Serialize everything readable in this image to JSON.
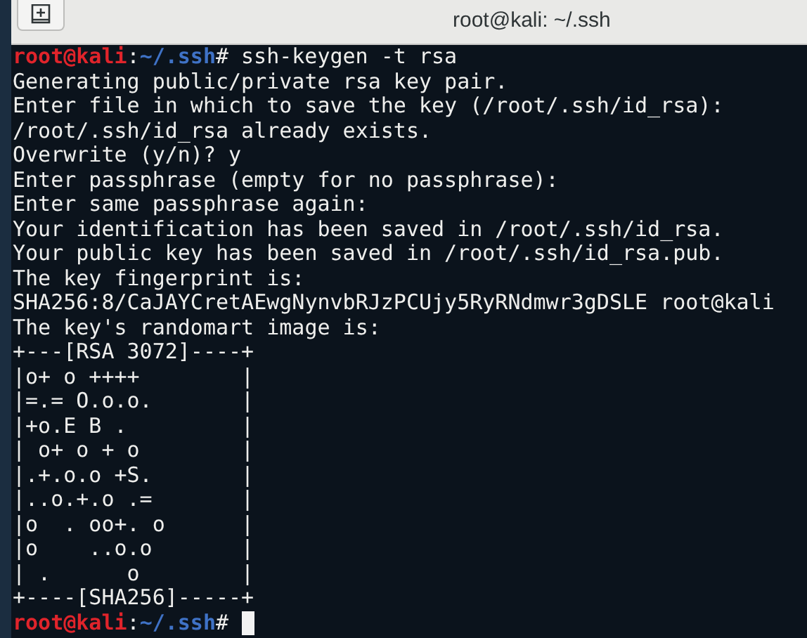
{
  "window": {
    "title": "root@kali: ~/.ssh"
  },
  "terminal": {
    "lines": [
      {
        "kind": "prompt",
        "host": "root@kali",
        "separator": ":",
        "path": "~/.ssh",
        "symbol": "#",
        "command": "ssh-keygen -t rsa"
      },
      {
        "kind": "output",
        "text": "Generating public/private rsa key pair."
      },
      {
        "kind": "output",
        "text": "Enter file in which to save the key (/root/.ssh/id_rsa):"
      },
      {
        "kind": "output",
        "text": "/root/.ssh/id_rsa already exists."
      },
      {
        "kind": "output",
        "text": "Overwrite (y/n)? y"
      },
      {
        "kind": "output",
        "text": "Enter passphrase (empty for no passphrase):"
      },
      {
        "kind": "output",
        "text": "Enter same passphrase again:"
      },
      {
        "kind": "output",
        "text": "Your identification has been saved in /root/.ssh/id_rsa."
      },
      {
        "kind": "output",
        "text": "Your public key has been saved in /root/.ssh/id_rsa.pub."
      },
      {
        "kind": "output",
        "text": "The key fingerprint is:"
      },
      {
        "kind": "output",
        "text": "SHA256:8/CaJAYCretAEwgNynvbRJzPCUjy5RyRNdmwr3gDSLE root@kali"
      },
      {
        "kind": "output",
        "text": "The key's randomart image is:"
      },
      {
        "kind": "output",
        "text": "+---[RSA 3072]----+"
      },
      {
        "kind": "output",
        "text": "|o+ o ++++        |"
      },
      {
        "kind": "output",
        "text": "|=.= O.o.o.       |"
      },
      {
        "kind": "output",
        "text": "|+o.E B .         |"
      },
      {
        "kind": "output",
        "text": "| o+ o + o        |"
      },
      {
        "kind": "output",
        "text": "|.+.o.o +S.       |"
      },
      {
        "kind": "output",
        "text": "|..o.+.o .=       |"
      },
      {
        "kind": "output",
        "text": "|o  . oo+. o      |"
      },
      {
        "kind": "output",
        "text": "|o    ..o.o       |"
      },
      {
        "kind": "output",
        "text": "| .      o        |"
      },
      {
        "kind": "output",
        "text": "+----[SHA256]-----+"
      },
      {
        "kind": "prompt",
        "host": "root@kali",
        "separator": ":",
        "path": "~/.ssh",
        "symbol": "#",
        "cursor": true
      }
    ]
  }
}
